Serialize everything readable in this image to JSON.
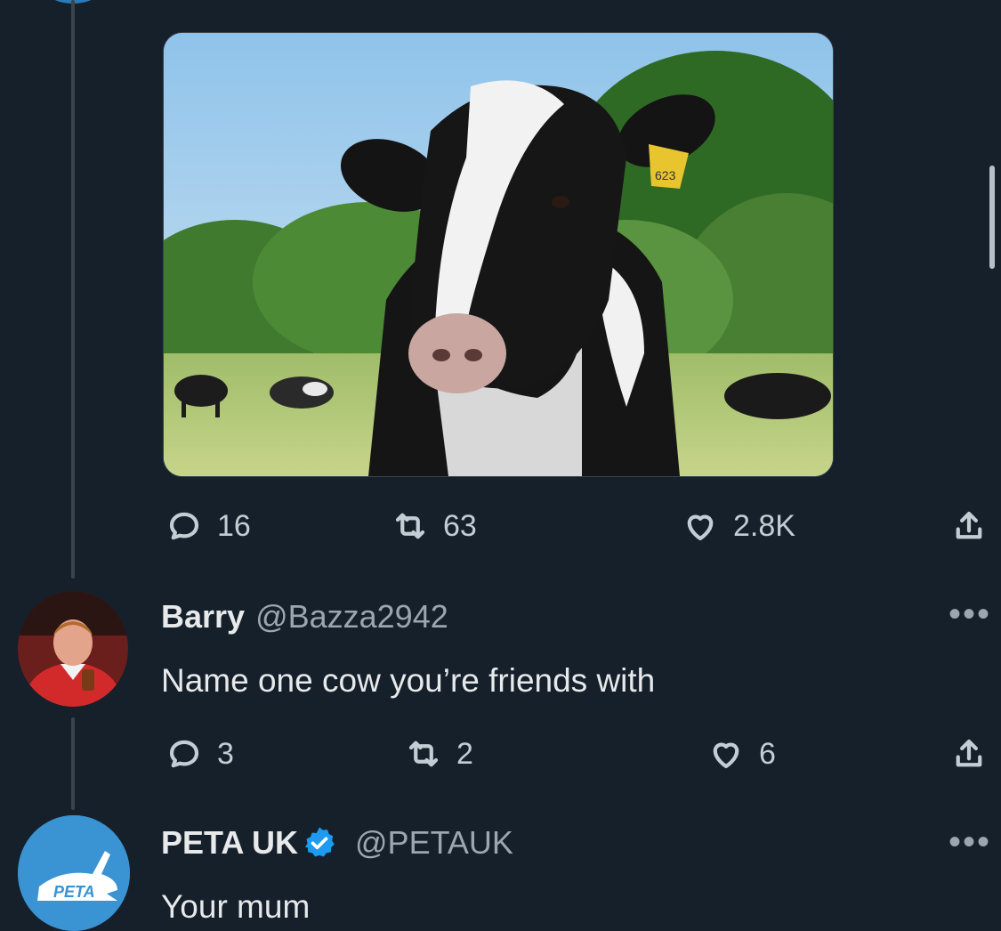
{
  "first_tweet": {
    "image_tag_number": "623",
    "stats": {
      "replies": "16",
      "retweets": "63",
      "likes": "2.8K"
    }
  },
  "reply_barry": {
    "display_name": "Barry",
    "handle": "@Bazza2942",
    "text": "Name one cow you’re friends with",
    "stats": {
      "replies": "3",
      "retweets": "2",
      "likes": "6"
    },
    "more": "•••"
  },
  "reply_peta": {
    "display_name": "PETA UK",
    "handle": "@PETAUK",
    "verified": true,
    "text": "Your mum",
    "logo_text": "PETA",
    "more": "•••"
  },
  "colors": {
    "background": "#15202b",
    "verified_blue": "#1d9bf0",
    "peta_blue": "#3a93d2"
  }
}
